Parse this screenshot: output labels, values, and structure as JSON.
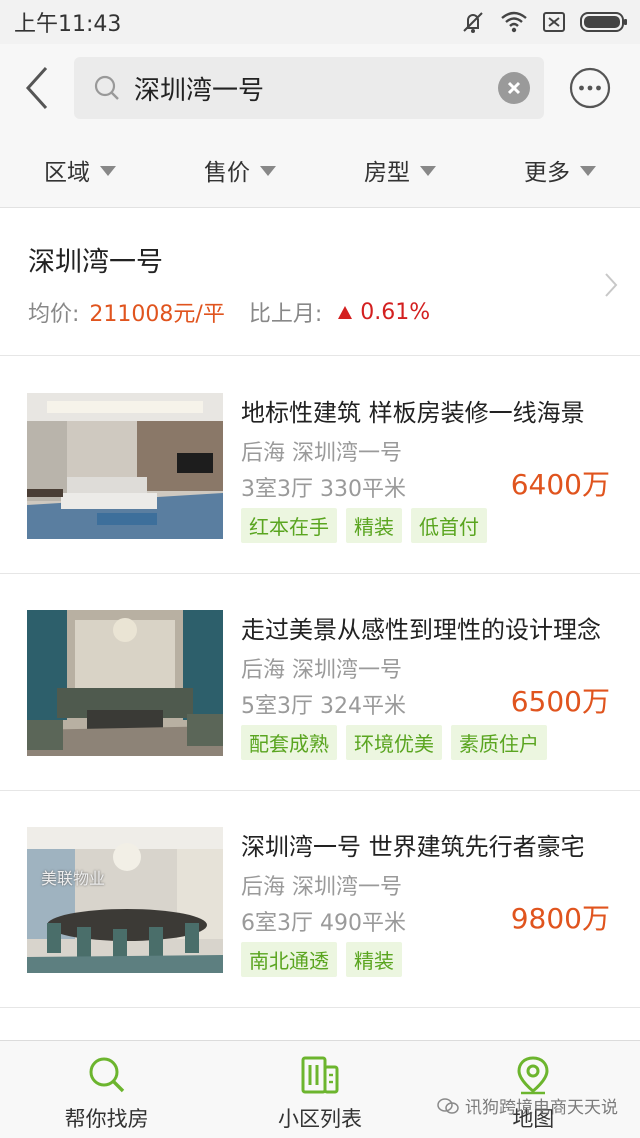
{
  "status_bar": {
    "time": "上午11:43"
  },
  "header": {
    "search_value": "深圳湾一号"
  },
  "filters": [
    {
      "label": "区域"
    },
    {
      "label": "售价"
    },
    {
      "label": "房型"
    },
    {
      "label": "更多"
    }
  ],
  "summary": {
    "title": "深圳湾一号",
    "avg_label": "均价:",
    "avg_price": "211008元/平",
    "mom_label": "比上月:",
    "mom_change": "0.61%"
  },
  "listings": [
    {
      "title": "地标性建筑 样板房装修一线海景",
      "location": "后海 深圳湾一号",
      "spec": "3室3厅 330平米",
      "price": "6400万",
      "tags": [
        "红本在手",
        "精装",
        "低首付"
      ]
    },
    {
      "title": "走过美景从感性到理性的设计理念",
      "location": "后海 深圳湾一号",
      "spec": "5室3厅 324平米",
      "price": "6500万",
      "tags": [
        "配套成熟",
        "环境优美",
        "素质住户"
      ]
    },
    {
      "title": "深圳湾一号 世界建筑先行者豪宅",
      "location": "后海 深圳湾一号",
      "spec": "6室3厅 490平米",
      "price": "9800万",
      "tags": [
        "南北通透",
        "精装"
      ]
    }
  ],
  "thumb_watermark": "美联物业",
  "bottom_nav": [
    {
      "label": "帮你找房",
      "icon": "search-icon"
    },
    {
      "label": "小区列表",
      "icon": "building-list-icon"
    },
    {
      "label": "地图",
      "icon": "map-pin-icon"
    }
  ],
  "watermark": "讯狗跨境电商天天说",
  "colors": {
    "accent_green": "#5aa520",
    "price_orange": "#e0541e",
    "rise_red": "#d32020"
  }
}
